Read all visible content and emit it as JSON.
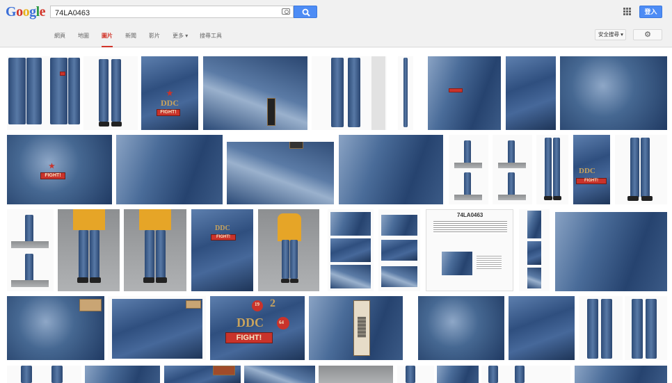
{
  "brand": {
    "logo_letters": [
      "G",
      "o",
      "o",
      "g",
      "l",
      "e"
    ]
  },
  "search": {
    "query": "74LA0463",
    "placeholder": ""
  },
  "header": {
    "signin_label": "登入"
  },
  "nav": {
    "tabs": [
      "網頁",
      "地圖",
      "圖片",
      "新聞",
      "影片",
      "更多 ▾",
      "搜尋工具"
    ],
    "active_tab": "圖片",
    "safe_search_label": "安全搜尋 ▾"
  },
  "results": {
    "card_text": {
      "title": "74LA0463"
    },
    "patch_text": {
      "ddc": "DDC",
      "fight": "FIGHT!",
      "num2": "2",
      "num19": "19",
      "num64": "64"
    }
  },
  "colors": {
    "accent": "#4d8cf5",
    "active_tab": "#d2352a",
    "denim_dark": "#2f4f7f"
  }
}
